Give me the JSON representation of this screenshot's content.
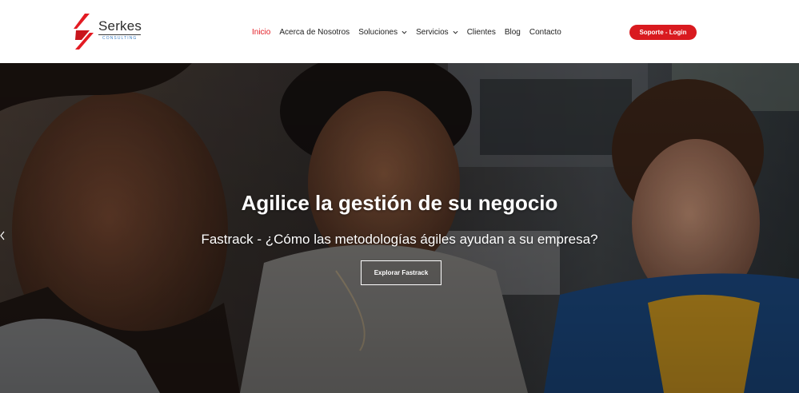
{
  "header": {
    "logo": {
      "brand": "Serkes",
      "tagline": "CONSULTING",
      "icon": "serkes-s-logo-icon"
    },
    "nav": [
      {
        "label": "Inicio",
        "active": true,
        "has_dropdown": false
      },
      {
        "label": "Acerca de Nosotros",
        "active": false,
        "has_dropdown": false
      },
      {
        "label": "Soluciones",
        "active": false,
        "has_dropdown": true
      },
      {
        "label": "Servicios",
        "active": false,
        "has_dropdown": true
      },
      {
        "label": "Clientes",
        "active": false,
        "has_dropdown": false
      },
      {
        "label": "Blog",
        "active": false,
        "has_dropdown": false
      },
      {
        "label": "Contacto",
        "active": false,
        "has_dropdown": false
      }
    ],
    "support_button": "Soporte - Login"
  },
  "hero": {
    "title": "Agilice la gestión de su negocio",
    "subtitle": "Fastrack - ¿Cómo las metodologías ágiles ayudan a su empresa?",
    "button": "Explorar Fastrack",
    "prev_icon": "chevron-left-icon"
  },
  "colors": {
    "accent": "#e31b23",
    "button_bg": "#d91a1f",
    "logo_sub": "#3b7fc4",
    "hero_text": "#ffffff"
  }
}
